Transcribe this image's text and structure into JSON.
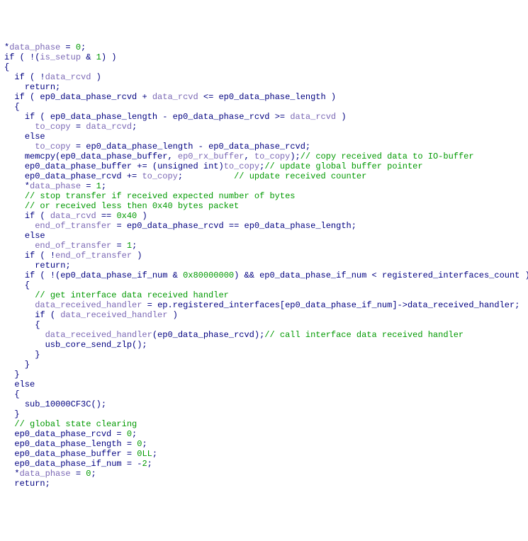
{
  "code": {
    "lines": [
      {
        "tokens": [
          {
            "t": "*",
            "c": "p"
          },
          {
            "t": "data_phase",
            "c": "v"
          },
          {
            "t": " = ",
            "c": "p"
          },
          {
            "t": "0",
            "c": "n"
          },
          {
            "t": ";",
            "c": "p"
          }
        ]
      },
      {
        "tokens": [
          {
            "t": "if",
            "c": "k"
          },
          {
            "t": " ( !(",
            "c": "p"
          },
          {
            "t": "is_setup",
            "c": "v"
          },
          {
            "t": " & ",
            "c": "p"
          },
          {
            "t": "1",
            "c": "n"
          },
          {
            "t": ") )",
            "c": "p"
          }
        ]
      },
      {
        "tokens": [
          {
            "t": "{",
            "c": "p"
          }
        ]
      },
      {
        "tokens": [
          {
            "t": "  ",
            "c": "p"
          },
          {
            "t": "if",
            "c": "k"
          },
          {
            "t": " ( !",
            "c": "p"
          },
          {
            "t": "data_rcvd",
            "c": "v"
          },
          {
            "t": " )",
            "c": "p"
          }
        ]
      },
      {
        "tokens": [
          {
            "t": "    ",
            "c": "p"
          },
          {
            "t": "return",
            "c": "k"
          },
          {
            "t": ";",
            "c": "p"
          }
        ]
      },
      {
        "tokens": [
          {
            "t": "  ",
            "c": "p"
          },
          {
            "t": "if",
            "c": "k"
          },
          {
            "t": " ( ",
            "c": "p"
          },
          {
            "t": "ep0_data_phase_rcvd",
            "c": "id"
          },
          {
            "t": " + ",
            "c": "p"
          },
          {
            "t": "data_rcvd",
            "c": "v"
          },
          {
            "t": " <= ",
            "c": "p"
          },
          {
            "t": "ep0_data_phase_length",
            "c": "id"
          },
          {
            "t": " )",
            "c": "p"
          }
        ]
      },
      {
        "tokens": [
          {
            "t": "  {",
            "c": "p"
          }
        ]
      },
      {
        "tokens": [
          {
            "t": "    ",
            "c": "p"
          },
          {
            "t": "if",
            "c": "k"
          },
          {
            "t": " ( ",
            "c": "p"
          },
          {
            "t": "ep0_data_phase_length",
            "c": "id"
          },
          {
            "t": " - ",
            "c": "p"
          },
          {
            "t": "ep0_data_phase_rcvd",
            "c": "id"
          },
          {
            "t": " >= ",
            "c": "p"
          },
          {
            "t": "data_rcvd",
            "c": "v"
          },
          {
            "t": " )",
            "c": "p"
          }
        ]
      },
      {
        "tokens": [
          {
            "t": "      ",
            "c": "p"
          },
          {
            "t": "to_copy",
            "c": "v"
          },
          {
            "t": " = ",
            "c": "p"
          },
          {
            "t": "data_rcvd",
            "c": "v"
          },
          {
            "t": ";",
            "c": "p"
          }
        ]
      },
      {
        "tokens": [
          {
            "t": "    ",
            "c": "p"
          },
          {
            "t": "else",
            "c": "k"
          }
        ]
      },
      {
        "tokens": [
          {
            "t": "      ",
            "c": "p"
          },
          {
            "t": "to_copy",
            "c": "v"
          },
          {
            "t": " = ",
            "c": "p"
          },
          {
            "t": "ep0_data_phase_length",
            "c": "id"
          },
          {
            "t": " - ",
            "c": "p"
          },
          {
            "t": "ep0_data_phase_rcvd",
            "c": "id"
          },
          {
            "t": ";",
            "c": "p"
          }
        ]
      },
      {
        "tokens": [
          {
            "t": "    ",
            "c": "p"
          },
          {
            "t": "memcpy",
            "c": "fn"
          },
          {
            "t": "(",
            "c": "p"
          },
          {
            "t": "ep0_data_phase_buffer",
            "c": "id"
          },
          {
            "t": ", ",
            "c": "p"
          },
          {
            "t": "ep0_rx_buffer",
            "c": "v"
          },
          {
            "t": ", ",
            "c": "p"
          },
          {
            "t": "to_copy",
            "c": "v"
          },
          {
            "t": ");",
            "c": "p"
          },
          {
            "t": "// copy received data to IO-buffer",
            "c": "c"
          }
        ]
      },
      {
        "tokens": [
          {
            "t": "    ",
            "c": "p"
          },
          {
            "t": "ep0_data_phase_buffer",
            "c": "id"
          },
          {
            "t": " += (",
            "c": "p"
          },
          {
            "t": "unsigned",
            "c": "k"
          },
          {
            "t": " ",
            "c": "p"
          },
          {
            "t": "int",
            "c": "k"
          },
          {
            "t": ")",
            "c": "p"
          },
          {
            "t": "to_copy",
            "c": "v"
          },
          {
            "t": ";",
            "c": "p"
          },
          {
            "t": "// update global buffer pointer",
            "c": "c"
          }
        ]
      },
      {
        "tokens": [
          {
            "t": "    ",
            "c": "p"
          },
          {
            "t": "ep0_data_phase_rcvd",
            "c": "id"
          },
          {
            "t": " += ",
            "c": "p"
          },
          {
            "t": "to_copy",
            "c": "v"
          },
          {
            "t": ";          ",
            "c": "p"
          },
          {
            "t": "// update received counter",
            "c": "c"
          }
        ]
      },
      {
        "tokens": [
          {
            "t": "    *",
            "c": "p"
          },
          {
            "t": "data_phase",
            "c": "v"
          },
          {
            "t": " = ",
            "c": "p"
          },
          {
            "t": "1",
            "c": "n"
          },
          {
            "t": ";",
            "c": "p"
          }
        ]
      },
      {
        "tokens": [
          {
            "t": "    ",
            "c": "p"
          },
          {
            "t": "// stop transfer if received expected number of bytes",
            "c": "c"
          }
        ]
      },
      {
        "tokens": [
          {
            "t": "    ",
            "c": "p"
          },
          {
            "t": "// or received less then 0x40 bytes packet",
            "c": "c"
          }
        ]
      },
      {
        "tokens": [
          {
            "t": "    ",
            "c": "p"
          },
          {
            "t": "if",
            "c": "k"
          },
          {
            "t": " ( ",
            "c": "p"
          },
          {
            "t": "data_rcvd",
            "c": "v"
          },
          {
            "t": " == ",
            "c": "p"
          },
          {
            "t": "0x40",
            "c": "n"
          },
          {
            "t": " )",
            "c": "p"
          }
        ]
      },
      {
        "tokens": [
          {
            "t": "      ",
            "c": "p"
          },
          {
            "t": "end_of_transfer",
            "c": "v"
          },
          {
            "t": " = ",
            "c": "p"
          },
          {
            "t": "ep0_data_phase_rcvd",
            "c": "id"
          },
          {
            "t": " == ",
            "c": "p"
          },
          {
            "t": "ep0_data_phase_length",
            "c": "id"
          },
          {
            "t": ";",
            "c": "p"
          }
        ]
      },
      {
        "tokens": [
          {
            "t": "    ",
            "c": "p"
          },
          {
            "t": "else",
            "c": "k"
          }
        ]
      },
      {
        "tokens": [
          {
            "t": "      ",
            "c": "p"
          },
          {
            "t": "end_of_transfer",
            "c": "v"
          },
          {
            "t": " = ",
            "c": "p"
          },
          {
            "t": "1",
            "c": "n"
          },
          {
            "t": ";",
            "c": "p"
          }
        ]
      },
      {
        "tokens": [
          {
            "t": "    ",
            "c": "p"
          },
          {
            "t": "if",
            "c": "k"
          },
          {
            "t": " ( !",
            "c": "p"
          },
          {
            "t": "end_of_transfer",
            "c": "v"
          },
          {
            "t": " )",
            "c": "p"
          }
        ]
      },
      {
        "tokens": [
          {
            "t": "      ",
            "c": "p"
          },
          {
            "t": "return",
            "c": "k"
          },
          {
            "t": ";",
            "c": "p"
          }
        ]
      },
      {
        "tokens": [
          {
            "t": "    ",
            "c": "p"
          },
          {
            "t": "if",
            "c": "k"
          },
          {
            "t": " ( !(",
            "c": "p"
          },
          {
            "t": "ep0_data_phase_if_num",
            "c": "id"
          },
          {
            "t": " & ",
            "c": "p"
          },
          {
            "t": "0x80000000",
            "c": "n"
          },
          {
            "t": ") && ",
            "c": "p"
          },
          {
            "t": "ep0_data_phase_if_num",
            "c": "id"
          },
          {
            "t": " < ",
            "c": "p"
          },
          {
            "t": "registered_interfaces_count",
            "c": "id"
          },
          {
            "t": " )",
            "c": "p"
          }
        ]
      },
      {
        "tokens": [
          {
            "t": "    {",
            "c": "p"
          }
        ]
      },
      {
        "tokens": [
          {
            "t": "      ",
            "c": "p"
          },
          {
            "t": "// get interface data received handler",
            "c": "c"
          }
        ]
      },
      {
        "tokens": [
          {
            "t": "      ",
            "c": "p"
          },
          {
            "t": "data_received_handler",
            "c": "v"
          },
          {
            "t": " = ",
            "c": "p"
          },
          {
            "t": "ep",
            "c": "id"
          },
          {
            "t": ".",
            "c": "p"
          },
          {
            "t": "registered_interfaces",
            "c": "id"
          },
          {
            "t": "[",
            "c": "p"
          },
          {
            "t": "ep0_data_phase_if_num",
            "c": "id"
          },
          {
            "t": "]->",
            "c": "p"
          },
          {
            "t": "data_received_handler",
            "c": "id"
          },
          {
            "t": ";",
            "c": "p"
          }
        ]
      },
      {
        "tokens": [
          {
            "t": "      ",
            "c": "p"
          },
          {
            "t": "if",
            "c": "k"
          },
          {
            "t": " ( ",
            "c": "p"
          },
          {
            "t": "data_received_handler",
            "c": "v"
          },
          {
            "t": " )",
            "c": "p"
          }
        ]
      },
      {
        "tokens": [
          {
            "t": "      {",
            "c": "p"
          }
        ]
      },
      {
        "tokens": [
          {
            "t": "        ",
            "c": "p"
          },
          {
            "t": "data_received_handler",
            "c": "v"
          },
          {
            "t": "(",
            "c": "p"
          },
          {
            "t": "ep0_data_phase_rcvd",
            "c": "id"
          },
          {
            "t": ");",
            "c": "p"
          },
          {
            "t": "// call interface data received handler",
            "c": "c"
          }
        ]
      },
      {
        "tokens": [
          {
            "t": "        ",
            "c": "p"
          },
          {
            "t": "usb_core_send_zlp",
            "c": "fn"
          },
          {
            "t": "();",
            "c": "p"
          }
        ]
      },
      {
        "tokens": [
          {
            "t": "      }",
            "c": "p"
          }
        ]
      },
      {
        "tokens": [
          {
            "t": "    }",
            "c": "p"
          }
        ]
      },
      {
        "tokens": [
          {
            "t": "  }",
            "c": "p"
          }
        ]
      },
      {
        "tokens": [
          {
            "t": "  ",
            "c": "p"
          },
          {
            "t": "else",
            "c": "k"
          }
        ]
      },
      {
        "tokens": [
          {
            "t": "  {",
            "c": "p"
          }
        ]
      },
      {
        "tokens": [
          {
            "t": "    ",
            "c": "p"
          },
          {
            "t": "sub_10000CF3C",
            "c": "fn"
          },
          {
            "t": "();",
            "c": "p"
          }
        ]
      },
      {
        "tokens": [
          {
            "t": "  }",
            "c": "p"
          }
        ]
      },
      {
        "tokens": [
          {
            "t": "  ",
            "c": "p"
          },
          {
            "t": "// global state clearing",
            "c": "c"
          }
        ]
      },
      {
        "tokens": [
          {
            "t": "  ",
            "c": "p"
          },
          {
            "t": "ep0_data_phase_rcvd",
            "c": "id"
          },
          {
            "t": " = ",
            "c": "p"
          },
          {
            "t": "0",
            "c": "n"
          },
          {
            "t": ";",
            "c": "p"
          }
        ]
      },
      {
        "tokens": [
          {
            "t": "  ",
            "c": "p"
          },
          {
            "t": "ep0_data_phase_length",
            "c": "id"
          },
          {
            "t": " = ",
            "c": "p"
          },
          {
            "t": "0",
            "c": "n"
          },
          {
            "t": ";",
            "c": "p"
          }
        ]
      },
      {
        "tokens": [
          {
            "t": "  ",
            "c": "p"
          },
          {
            "t": "ep0_data_phase_buffer",
            "c": "id"
          },
          {
            "t": " = ",
            "c": "p"
          },
          {
            "t": "0LL",
            "c": "n"
          },
          {
            "t": ";",
            "c": "p"
          }
        ]
      },
      {
        "tokens": [
          {
            "t": "  ",
            "c": "p"
          },
          {
            "t": "ep0_data_phase_if_num",
            "c": "id"
          },
          {
            "t": " = -",
            "c": "p"
          },
          {
            "t": "2",
            "c": "n"
          },
          {
            "t": ";",
            "c": "p"
          }
        ]
      },
      {
        "tokens": [
          {
            "t": "  *",
            "c": "p"
          },
          {
            "t": "data_phase",
            "c": "v"
          },
          {
            "t": " = ",
            "c": "p"
          },
          {
            "t": "0",
            "c": "n"
          },
          {
            "t": ";",
            "c": "p"
          }
        ]
      },
      {
        "tokens": [
          {
            "t": "  ",
            "c": "p"
          },
          {
            "t": "return",
            "c": "k"
          },
          {
            "t": ";",
            "c": "p"
          }
        ]
      }
    ]
  }
}
